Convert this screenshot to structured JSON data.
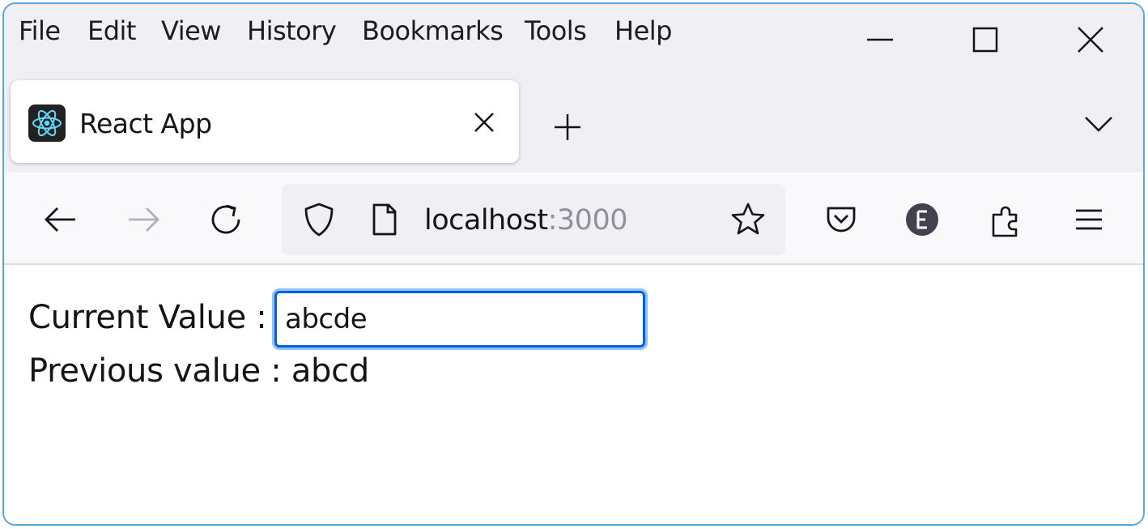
{
  "menu": {
    "items": [
      "File",
      "Edit",
      "View",
      "History",
      "Bookmarks",
      "Tools",
      "Help"
    ]
  },
  "window_controls": {
    "minimize_icon": "minimize-icon",
    "maximize_icon": "maximize-icon",
    "close_icon": "close-icon"
  },
  "tabs": [
    {
      "title": "React App",
      "favicon": "react-logo-icon",
      "active": true
    }
  ],
  "navigation": {
    "url_host": "localhost",
    "url_port": ":3000"
  },
  "page": {
    "current_label": "Current Value :",
    "current_value": "abcde",
    "previous_label": "Previous value :",
    "previous_value": "abcd"
  },
  "colors": {
    "accent": "#0060df",
    "chrome_bg": "#f0f0f4",
    "window_border": "#5aa7e0"
  }
}
